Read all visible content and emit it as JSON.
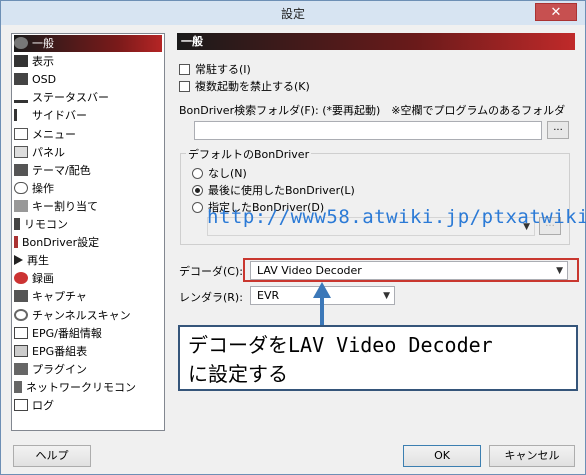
{
  "window": {
    "title": "設定",
    "close_glyph": "✕"
  },
  "sidebar": {
    "items": [
      {
        "label": "一般",
        "icon": "gear-icon",
        "selected": true
      },
      {
        "label": "表示",
        "icon": "display-icon"
      },
      {
        "label": "OSD",
        "icon": "osd-icon"
      },
      {
        "label": "ステータスバー",
        "icon": "statusbar-icon"
      },
      {
        "label": "サイドバー",
        "icon": "sidebar-icon"
      },
      {
        "label": "メニュー",
        "icon": "menu-icon"
      },
      {
        "label": "パネル",
        "icon": "panel-icon"
      },
      {
        "label": "テーマ/配色",
        "icon": "theme-icon"
      },
      {
        "label": "操作",
        "icon": "mouse-icon"
      },
      {
        "label": "キー割り当て",
        "icon": "keyboard-icon"
      },
      {
        "label": "リモコン",
        "icon": "remote-icon"
      },
      {
        "label": "BonDriver設定",
        "icon": "bondriver-icon"
      },
      {
        "label": "再生",
        "icon": "play-icon"
      },
      {
        "label": "録画",
        "icon": "record-icon"
      },
      {
        "label": "キャプチャ",
        "icon": "camera-icon"
      },
      {
        "label": "チャンネルスキャン",
        "icon": "scan-icon"
      },
      {
        "label": "EPG/番組情報",
        "icon": "epg-icon"
      },
      {
        "label": "EPG番組表",
        "icon": "epg-table-icon"
      },
      {
        "label": "プラグイン",
        "icon": "plugin-icon"
      },
      {
        "label": "ネットワークリモコン",
        "icon": "network-remote-icon"
      },
      {
        "label": "ログ",
        "icon": "log-icon"
      }
    ]
  },
  "panel": {
    "header": "一般",
    "checkbox_resident": "常駐する(I)",
    "checkbox_multi": "複数起動を禁止する(K)",
    "bondriver_folder_label": "BonDriver検索フォルダ(F): (*要再起動)　※空欄でプログラムのあるフォルダ",
    "bondriver_folder_value": "",
    "browse_label": "...",
    "default_group_title": "デフォルトのBonDriver",
    "radio_none": "なし(N)",
    "radio_last": "最後に使用したBonDriver(L)",
    "radio_specified": "指定したBonDriver(D)",
    "specified_browse_label": "...",
    "decoder_label": "デコーダ(C):",
    "decoder_value": "LAV Video Decoder",
    "renderer_label": "レンダラ(R):",
    "renderer_value": "EVR"
  },
  "overlay": {
    "watermark": "http://www58.atwiki.jp/ptxatwiki",
    "callout_line1": "デコーダをLAV Video Decoder",
    "callout_line2": "に設定する",
    "highlight_color": "#c9372f",
    "arrow_color": "#3c78b8"
  },
  "buttons": {
    "help": "ヘルプ",
    "ok": "OK",
    "cancel": "キャンセル"
  }
}
